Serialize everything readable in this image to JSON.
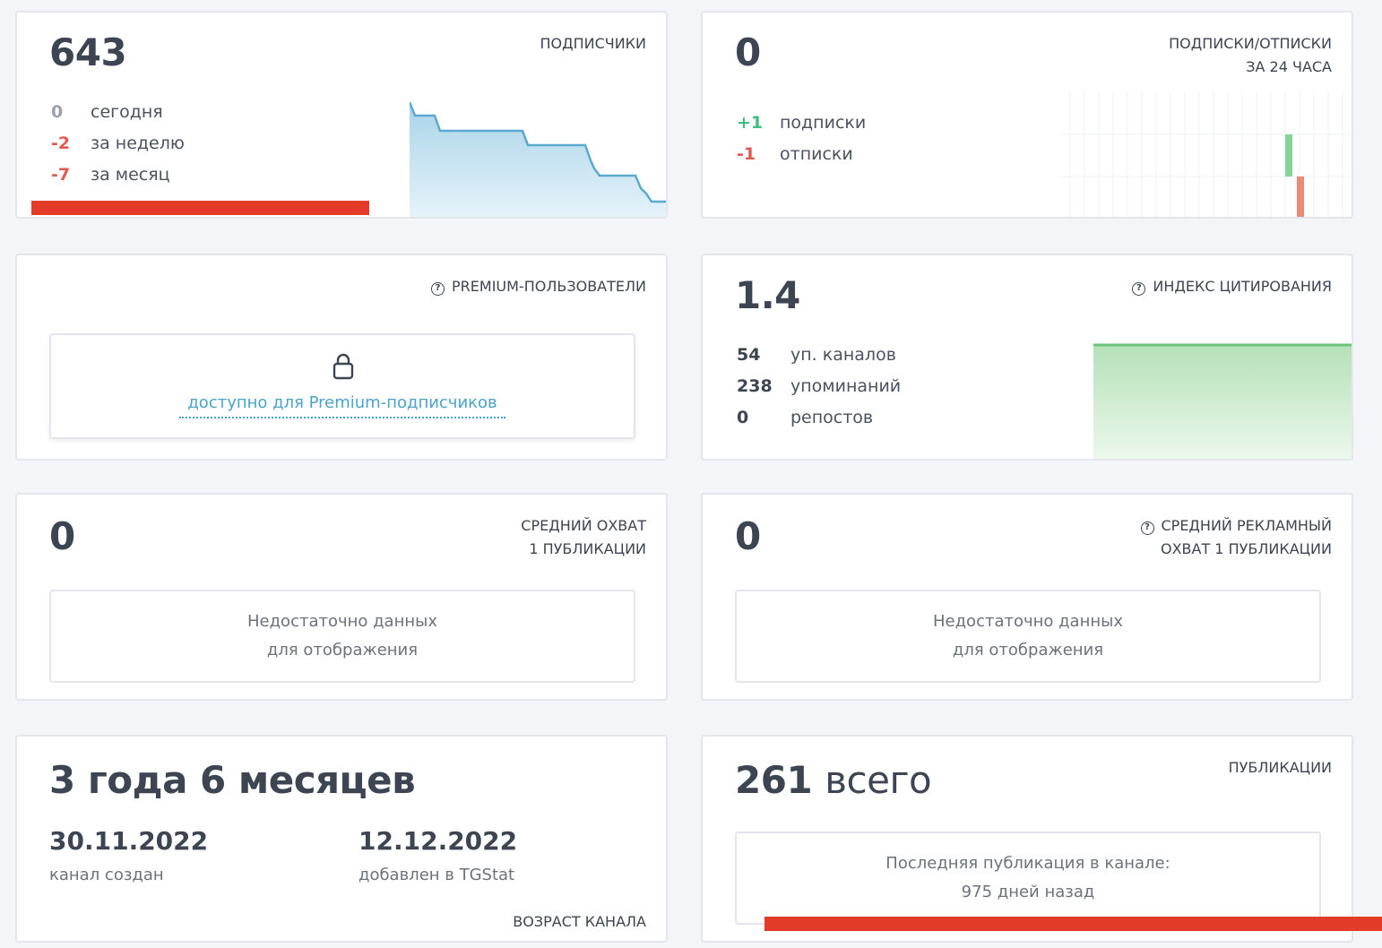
{
  "subscribers": {
    "title": "ПОДПИСЧИКИ",
    "count": "643",
    "rows": [
      {
        "value": "0",
        "label": "сегодня"
      },
      {
        "value": "-2",
        "label": "за неделю"
      },
      {
        "value": "-7",
        "label": "за месяц"
      }
    ]
  },
  "subs_24h": {
    "title_line1": "ПОДПИСКИ/ОТПИСКИ",
    "title_line2": "ЗА 24 ЧАСА",
    "count": "0",
    "rows": [
      {
        "value": "+1",
        "label": "подписки"
      },
      {
        "value": "-1",
        "label": "отписки"
      }
    ]
  },
  "premium": {
    "title": "PREMIUM-ПОЛЬЗОВАТЕЛИ",
    "locked_text": "доступно для Premium-подписчиков",
    "icon": "lock-icon"
  },
  "citation": {
    "title": "ИНДЕКС ЦИТИРОВАНИЯ",
    "value": "1.4",
    "rows": [
      {
        "value": "54",
        "label": "уп. каналов"
      },
      {
        "value": "238",
        "label": "упоминаний"
      },
      {
        "value": "0",
        "label": "репостов"
      }
    ]
  },
  "avg_reach": {
    "title_line1": "СРЕДНИЙ ОХВАТ",
    "title_line2": "1 ПУБЛИКАЦИИ",
    "value": "0",
    "empty_line1": "Недостаточно данных",
    "empty_line2": "для отображения"
  },
  "avg_ad_reach": {
    "title_line1": "СРЕДНИЙ РЕКЛАМНЫЙ",
    "title_line2": "ОХВАТ 1 ПУБЛИКАЦИИ",
    "value": "0",
    "empty_line1": "Недостаточно данных",
    "empty_line2": "для отображения"
  },
  "channel_age": {
    "title": "ВОЗРАСТ КАНАЛА",
    "value": "3 года 6 месяцев",
    "created_date": "30.11.2022",
    "created_label": "канал создан",
    "added_date": "12.12.2022",
    "added_label": "добавлен в TGStat"
  },
  "publications": {
    "title": "ПУБЛИКАЦИИ",
    "count": "261",
    "count_suffix": "всего",
    "last_line1": "Последняя публикация в канале:",
    "last_line2": "975 дней назад"
  },
  "colors": {
    "accent_blue": "#5aa9cf",
    "accent_green": "#6cc27a",
    "negative_red": "#e25a4f",
    "redaction": "#e33b27"
  }
}
